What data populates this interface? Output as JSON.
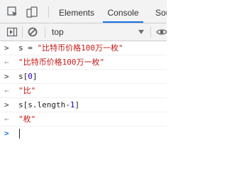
{
  "tabs": [
    {
      "label": "Elements",
      "active": false
    },
    {
      "label": "Console",
      "active": true
    },
    {
      "label": "Sou",
      "active": false
    }
  ],
  "toolbar": {
    "context": "top"
  },
  "console": {
    "line1": {
      "var": "s",
      "op": " = ",
      "str": "\"比特币价格100万一枚\""
    },
    "line2": {
      "str": "\"比特币价格100万一枚\""
    },
    "line3": {
      "var": "s",
      "open": "[",
      "num": "0",
      "close": "]"
    },
    "line4": {
      "str": "\"比\""
    },
    "line5": {
      "expr": "s[s.length-",
      "num": "1",
      "close": "]"
    },
    "line6": {
      "str": "\"枚\""
    }
  },
  "icons": {
    "inspect": "inspect-element-icon",
    "device": "device-toolbar-icon",
    "drawer": "show-drawer-icon",
    "clear": "clear-console-icon",
    "eye": "live-expression-eye-icon"
  },
  "colors": {
    "accent": "#1a73e8",
    "string": "#c41a16",
    "number": "#1c00cf"
  }
}
